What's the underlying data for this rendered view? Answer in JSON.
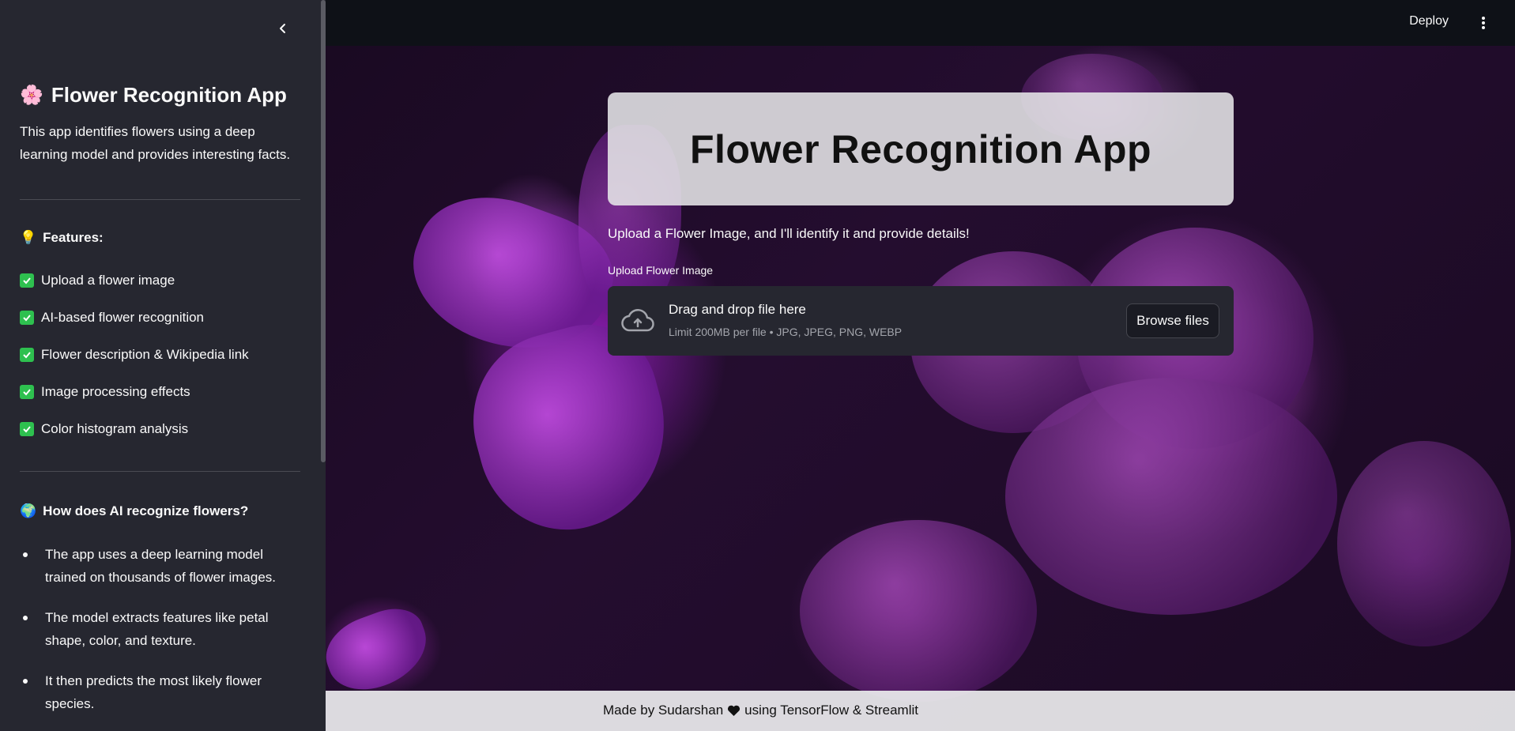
{
  "header": {
    "deploy_label": "Deploy"
  },
  "sidebar": {
    "title": "Flower Recognition App",
    "title_emoji": "🌸",
    "description": "This app identifies flowers using a deep learning model and provides interesting facts.",
    "features_heading": "Features:",
    "features_emoji": "💡",
    "features": [
      "Upload a flower image",
      "AI-based flower recognition",
      "Flower description & Wikipedia link",
      "Image processing effects",
      "Color histogram analysis"
    ],
    "ai_heading": "How does AI recognize flowers?",
    "ai_emoji": "🌍",
    "ai_points": [
      "The app uses a deep learning model trained on thousands of flower images.",
      "The model extracts features like petal shape, color, and texture.",
      "It then predicts the most likely flower species."
    ]
  },
  "main": {
    "title": "Flower Recognition App",
    "subtitle": "Upload a Flower Image, and I'll identify it and provide details!",
    "upload_label": "Upload Flower Image",
    "dropzone_title": "Drag and drop file here",
    "dropzone_limit": "Limit 200MB per file • JPG, JPEG, PNG, WEBP",
    "browse_label": "Browse files"
  },
  "footer": {
    "text_before": "Made by Sudarshan",
    "text_after": "using TensorFlow & Streamlit"
  },
  "colors": {
    "sidebar_bg": "#262730",
    "app_bg": "#0e1117",
    "check_green": "#2ec04f",
    "accent_purple": "#a64ac9"
  }
}
